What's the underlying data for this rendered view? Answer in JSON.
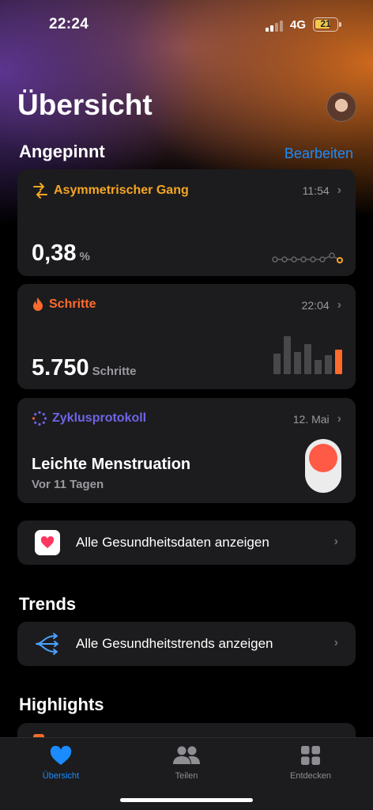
{
  "status_bar": {
    "time": "22:24",
    "network": "4G",
    "battery": "21"
  },
  "page_title": "Übersicht",
  "pinned": {
    "heading": "Angepinnt",
    "edit_label": "Bearbeiten",
    "cards": [
      {
        "title": "Asymmetrischer Gang",
        "time": "11:54",
        "value": "0,38",
        "unit": "%",
        "color": "#f5a623",
        "icon": "asymmetry-arrows-icon"
      },
      {
        "title": "Schritte",
        "time": "22:04",
        "value": "5.750",
        "unit": "Schritte",
        "color": "#ff6b2c",
        "icon": "flame-icon"
      },
      {
        "title": "Zyklusprotokoll",
        "time": "12. Mai",
        "value": "Leichte Menstruation",
        "subtitle": "Vor 11 Tagen",
        "color": "#6e64e6",
        "icon": "cycle-dots-icon"
      }
    ]
  },
  "all_health_data": {
    "label": "Alle Gesundheitsdaten anzeigen",
    "icon": "heart-app-icon"
  },
  "trends": {
    "heading": "Trends",
    "label": "Alle Gesundheitstrends anzeigen",
    "icon": "trend-arrows-icon"
  },
  "highlights": {
    "heading": "Highlights"
  },
  "tabbar": {
    "tabs": [
      {
        "label": "Übersicht",
        "icon": "heart-icon",
        "active": true
      },
      {
        "label": "Teilen",
        "icon": "people-icon",
        "active": false
      },
      {
        "label": "Entdecken",
        "icon": "grid-icon",
        "active": false
      }
    ]
  },
  "colors": {
    "accent": "#1a8cff",
    "card_bg": "#1c1c1e",
    "steps_bar_highlight": "#ff6b2c",
    "steps_bar": "#48484a",
    "cycle_dot": "#ff5a45"
  }
}
